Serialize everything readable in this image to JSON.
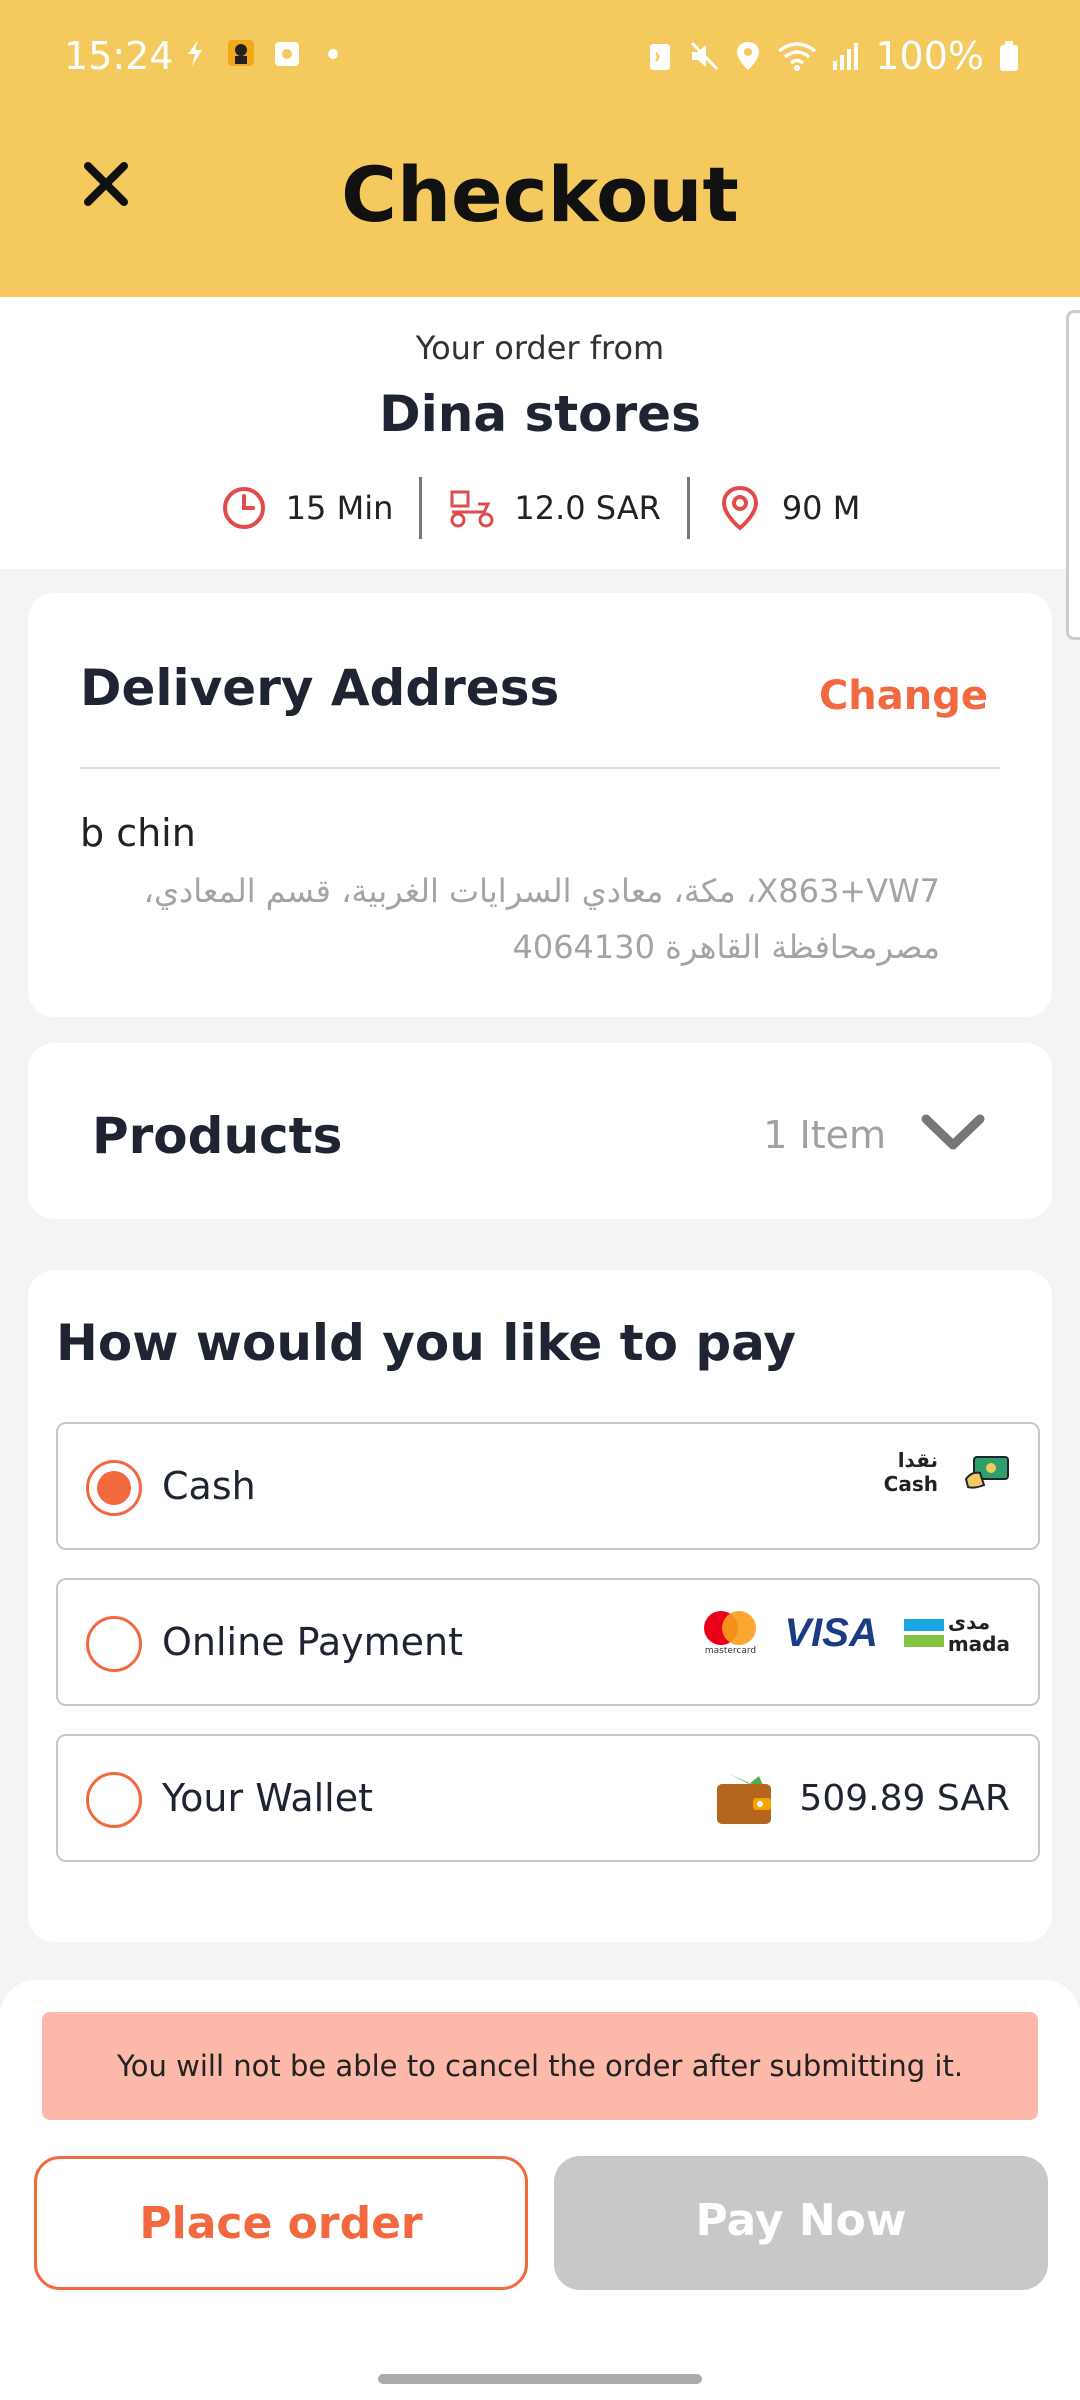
{
  "status_bar": {
    "time": "15:24",
    "battery": "100%"
  },
  "header": {
    "title": "Checkout"
  },
  "store": {
    "order_from": "Your order from",
    "name": "Dina stores",
    "eta": "15 Min",
    "delivery_fee": "12.0 SAR",
    "distance": "90 M"
  },
  "delivery": {
    "title": "Delivery Address",
    "change_label": "Change",
    "name": "b chin",
    "address": "X863+VW7، مكة، معادي السرايات الغربية، قسم المعادي، مصرمحافظة القاهرة 4064130"
  },
  "products": {
    "title": "Products",
    "count": "1 Item"
  },
  "payment": {
    "title": "How would you like to pay",
    "options": [
      {
        "label": "Cash",
        "selected": true,
        "badge_ar": "نقدا",
        "badge_en": "Cash"
      },
      {
        "label": "Online Payment",
        "selected": false,
        "visa": "VISA",
        "mada_ar": "مدى",
        "mada_en": "mada",
        "mastercard": "mastercard"
      },
      {
        "label": "Your Wallet",
        "selected": false,
        "amount": "509.89 SAR"
      }
    ]
  },
  "footer": {
    "warning": "You will not be able to cancel the order after submitting it.",
    "place_order": "Place order",
    "pay_now": "Pay Now"
  },
  "colors": {
    "header_bg": "#f4ca5e",
    "accent": "#f2693f",
    "warning_bg": "#fcb8a8",
    "disabled_btn": "#c8c8c8"
  }
}
